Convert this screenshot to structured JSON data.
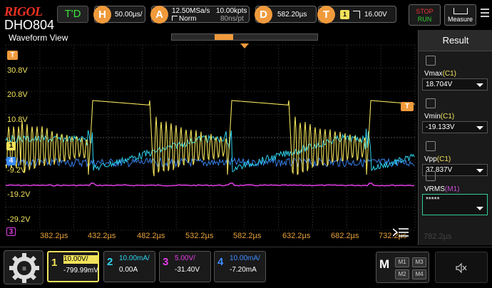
{
  "brand": {
    "logo": "RIGOL",
    "model": "DHO804"
  },
  "topbar": {
    "trigger_status": "T'D",
    "horizontal": {
      "letter": "H",
      "value": "50.00µs/"
    },
    "acquire": {
      "letter": "A",
      "rate": "12.50MSa/s",
      "points": "10.00kpts",
      "mode": "Norm",
      "interval": "80ns/pt"
    },
    "delay": {
      "letter": "D",
      "value": "582.20µs"
    },
    "trigger": {
      "letter": "T",
      "source": "1",
      "level": "16.00V"
    },
    "stop_run": {
      "stop": "STOP",
      "run": "RUN"
    },
    "measure_label": "Measure"
  },
  "waveform": {
    "title": "Waveform View",
    "v_labels": [
      "30.8V",
      "20.8V",
      "10.8V",
      "-9.2V",
      "-19.2V",
      "-29.2V"
    ],
    "t_labels": [
      "382.2µs",
      "432.2µs",
      "482.2µs",
      "532.2µs",
      "582.2µs",
      "632.2µs",
      "682.2µs",
      "732.2µs"
    ],
    "trigger_marker": "T",
    "ch_markers": [
      "1",
      "4",
      "3"
    ],
    "ghost_value": "782.2µs"
  },
  "result": {
    "title": "Result",
    "items": [
      {
        "name": "Vmax",
        "src": "(C1)",
        "value": "18.704V",
        "src_color": "#f1e25a"
      },
      {
        "name": "Vmin",
        "src": "(C1)",
        "value": "-19.133V",
        "src_color": "#f1e25a"
      },
      {
        "name": "Vpp",
        "src": "(C1)",
        "value": "37.837V",
        "src_color": "#f1e25a"
      },
      {
        "name": "VRMS",
        "src": "(M1)",
        "value": "*****",
        "src_color": "#c84fd6"
      }
    ]
  },
  "channels": [
    {
      "num": "1",
      "scale": "10.00V/",
      "offset": "-799.99mV",
      "color": "#f1e25a"
    },
    {
      "num": "2",
      "scale": "10.00mA/",
      "offset": "0.00A",
      "color": "#2fd4f0"
    },
    {
      "num": "3",
      "scale": "5.00V/",
      "offset": "-31.40V",
      "color": "#e23de6"
    },
    {
      "num": "4",
      "scale": "10.00mA/",
      "offset": "-7.20mA",
      "color": "#3b8cff"
    }
  ],
  "math": {
    "label": "M",
    "buttons": [
      "M1",
      "M3",
      "M2",
      "M4"
    ]
  },
  "colors": {
    "accent": "#f09a3c",
    "ch1": "#f1e25a",
    "ch2": "#2fd4f0",
    "ch3": "#e23de6",
    "ch4": "#3b8cff",
    "grid": "#3a3a3a"
  },
  "icons": {
    "gear": "gear-icon",
    "speaker": "speaker-mute-icon",
    "menu": "menu-icon"
  }
}
